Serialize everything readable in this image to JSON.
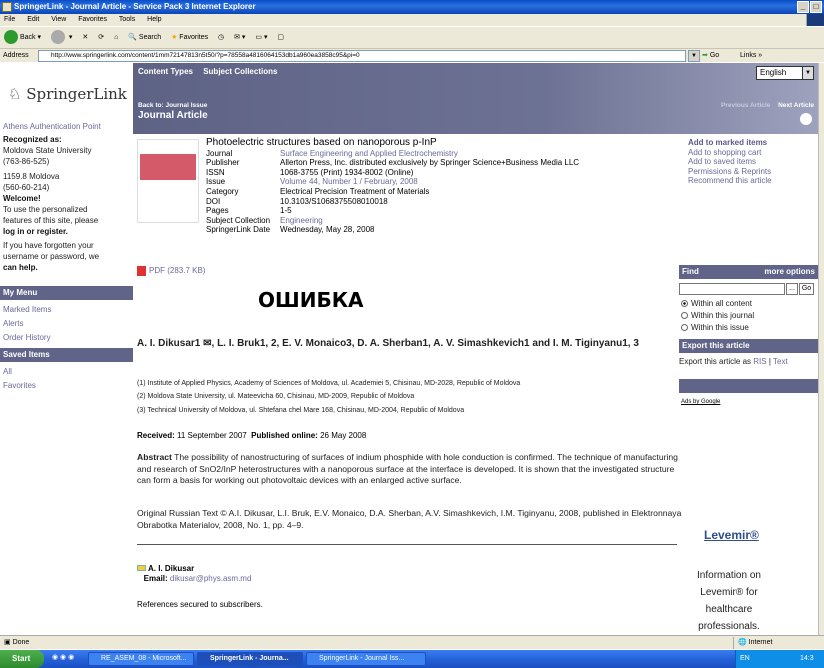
{
  "window": {
    "title": "SpringerLink - Journal Article - Service Pack 3 Internet Explorer"
  },
  "menu": [
    "File",
    "Edit",
    "View",
    "Favorites",
    "Tools",
    "Help"
  ],
  "toolbar": {
    "back": "Back",
    "search": "Search",
    "favorites": "Favorites"
  },
  "address": {
    "label": "Address",
    "url": "http://www.springerlink.com/content/1mm72147813n5t50/?p=78558a4816064153db1a960ea3858c95&pi=0",
    "go": "Go",
    "links": "Links"
  },
  "left": {
    "logo": "SpringerLink",
    "athens": "Athens Authentication Point",
    "recognized": "Recognized as:",
    "inst1": "Moldova State University",
    "inst1_num": "(763-86-525)",
    "inst2": "1159.8 Moldova",
    "inst2_num": "(560-60-214)",
    "welcome": "Welcome!",
    "personal1": "To use the personalized",
    "personal2": "features of this site, please",
    "login": "log in or register.",
    "forgot1": "If you have forgotten your",
    "forgot2": "username or password, we",
    "forgot3": "can help.",
    "mymenu": "My Menu",
    "marked": "Marked Items",
    "alerts": "Alerts",
    "orders": "Order History",
    "saved": "Saved Items",
    "all": "All",
    "favorites": "Favorites"
  },
  "nav": {
    "content_types": "Content Types",
    "subject_collections": "Subject Collections",
    "back_to": "Back to: Journal Issue",
    "journal_article": "Journal Article",
    "previous": "Previous Article",
    "next": "Next Article",
    "language": "English"
  },
  "meta": {
    "title": "Photoelectric structures based on nanoporous p-InP",
    "rows": [
      {
        "k": "Journal",
        "v": "Surface Engineering and Applied Electrochemistry",
        "link": true
      },
      {
        "k": "Publisher",
        "v": "Allerton Press, Inc. distributed exclusively by Springer Science+Business Media LLC",
        "link": false
      },
      {
        "k": "ISSN",
        "v": "1068-3755 (Print) 1934-8002 (Online)",
        "link": false
      },
      {
        "k": "Issue",
        "v": "Volume 44, Number 1 / February, 2008",
        "link": true
      },
      {
        "k": "Category",
        "v": "Electrical Precision Treatment of Materials",
        "link": false
      },
      {
        "k": "DOI",
        "v": "10.3103/S1068375508010018",
        "link": false
      },
      {
        "k": "Pages",
        "v": "1-5",
        "link": false
      },
      {
        "k": "Subject Collection",
        "v": "Engineering",
        "link": true
      },
      {
        "k": "SpringerLink Date",
        "v": "Wednesday, May 28, 2008",
        "link": false
      }
    ]
  },
  "actions": {
    "marked": "Add to marked items",
    "cart": "Add to shopping cart",
    "saved": "Add to saved items",
    "permissions": "Permissions & Reprints",
    "recommend": "Recommend this article"
  },
  "article": {
    "pdf": "PDF (283.7 KB)",
    "error": "ОШИБКА",
    "authors": "A. I. Dikusar1 ✉, L. I. Bruk1, 2, E. V. Monaico3, D. A. Sherban1, A. V. Simashkevich1 and I. M. Tiginyanu1, 3",
    "affil1": "(1) Institute of Applied Physics, Academy of Sciences of Moldova, ul. Academiei 5, Chisinau, MD-2028, Republic of Moldova",
    "affil2": "(2) Moldova State University, ul. Mateevicha 60, Chisinau, MD-2009, Republic of Moldova",
    "affil3": "(3) Technical University of Moldova, ul. Shtefana chel Mare 168, Chisinau, MD-2004, Republic of Moldova",
    "received_label": "Received:",
    "received": "11 September 2007",
    "published_label": "Published online:",
    "published": "26 May 2008",
    "abstract_label": "Abstract",
    "abstract": "The possibility of nanostructuring of surfaces of indium phosphide with hole conduction is confirmed. The technique of manufacturing and research of SnO2/InP heterostructures with a nanoporous surface at the interface is developed. It is shown that the investigated structure can form a basis for working out photovoltaic devices with an enlarged active surface.",
    "original": "Original Russian Text © A.I. Dikusar, L.I. Bruk, E.V. Monaico, D.A. Sherban, A.V. Simashkevich, I.M. Tiginyanu, 2008, published in Elektronnaya Obrabotka Materialov, 2008, No. 1, pp. 4–9.",
    "contact_name": "A. I. Dikusar",
    "email_label": "Email:",
    "email": "dikusar@phys.asm.md",
    "refs": "References secured to subscribers."
  },
  "sidebar": {
    "find": "Find",
    "more_options": "more options",
    "dots": "...",
    "go": "Go",
    "opt1": "Within all content",
    "opt2": "Within this journal",
    "opt3": "Within this issue",
    "export_hdr": "Export this article",
    "export_as": "Export this article as",
    "ris": "RIS",
    "sep": "|",
    "text": "Text",
    "ads": "Ads by Google",
    "levemir": "Levemir®",
    "lev1": "Information on",
    "lev2": "Levemir® for",
    "lev3": "healthcare",
    "lev4": "professionals."
  },
  "status": {
    "done": "Done",
    "internet": "Internet"
  },
  "taskbar": {
    "start": "Start",
    "t1": "RE_ASEM_08 - Microsoft...",
    "t2": "SpringerLink - Journa...",
    "t3": "SpringerLink - Journal Iss...",
    "lang": "EN",
    "time": "14:3"
  }
}
